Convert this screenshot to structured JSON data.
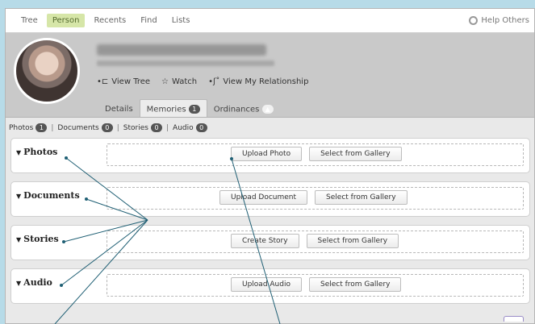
{
  "topnav": {
    "tabs": [
      {
        "label": "Tree"
      },
      {
        "label": "Person",
        "active": true
      },
      {
        "label": "Recents"
      },
      {
        "label": "Find"
      },
      {
        "label": "Lists"
      }
    ],
    "help_label": "Help Others"
  },
  "person": {
    "actions": {
      "view_tree": "View Tree",
      "watch": "Watch",
      "view_relationship": "View My Relationship"
    }
  },
  "subtabs": {
    "details": "Details",
    "memories": "Memories",
    "memories_count": "1",
    "ordinances": "Ordinances"
  },
  "filters": [
    {
      "label": "Photos",
      "count": "1"
    },
    {
      "label": "Documents",
      "count": "0"
    },
    {
      "label": "Stories",
      "count": "0"
    },
    {
      "label": "Audio",
      "count": "0"
    }
  ],
  "sections": [
    {
      "title": "Photos",
      "primary": "Upload Photo",
      "secondary": "Select from Gallery"
    },
    {
      "title": "Documents",
      "primary": "Upload Document",
      "secondary": "Select from Gallery"
    },
    {
      "title": "Stories",
      "primary": "Create Story",
      "secondary": "Select from Gallery"
    },
    {
      "title": "Audio",
      "primary": "Upload Audio",
      "secondary": "Select from Gallery"
    }
  ],
  "colors": {
    "background": "#b7dbe8",
    "active_tab": "#d6e6a8",
    "annotation_lines": "#1f5f74"
  },
  "icons": {
    "help": "help-circle-icon",
    "view_tree": "tree-icon",
    "watch": "star-icon",
    "relationship": "relationship-icon",
    "collapse": "triangle-down-icon"
  }
}
